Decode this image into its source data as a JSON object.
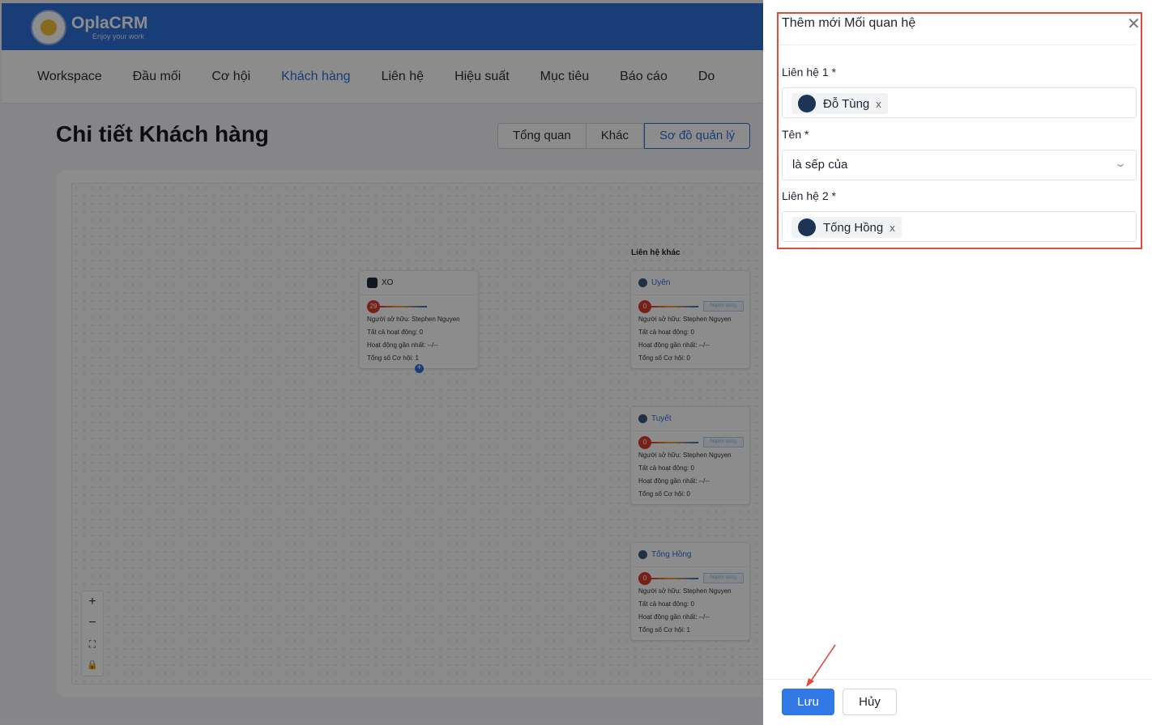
{
  "app": {
    "logo_name": "OplaCRM",
    "logo_tagline": "Enjoy your work",
    "nav": [
      "Workspace",
      "Đầu mối",
      "Cơ hội",
      "Khách hàng",
      "Liên hệ",
      "Hiệu suất",
      "Mục tiêu",
      "Báo cáo",
      "Do"
    ],
    "active_nav": "Khách hàng",
    "page_title": "Chi tiết Khách hàng",
    "view_tabs": [
      "Tổng quan",
      "Khác",
      "Sơ đồ quản lý"
    ],
    "active_view_tab": "Sơ đồ quản lý",
    "group_label": "Liên hệ khác",
    "nodes": [
      {
        "name": "XO",
        "score": "29",
        "owner": "Người sở hữu: Stephen Nguyen",
        "activities": "Tất cả hoạt động: 0",
        "last_activity": "Hoạt động gần nhất: --/--",
        "opportunities": "Tổng số Cơ hội: 1"
      },
      {
        "name": "Uyên",
        "score": "0",
        "badge": "Người dùng",
        "owner": "Người sở hữu: Stephen Nguyen",
        "activities": "Tất cả hoạt động: 0",
        "last_activity": "Hoạt động gần nhất: --/--",
        "opportunities": "Tổng số Cơ hội: 0"
      },
      {
        "name": "Tuyết",
        "score": "0",
        "badge": "Người dùng",
        "owner": "Người sở hữu: Stephen Nguyen",
        "activities": "Tất cả hoạt động: 0",
        "last_activity": "Hoạt động gần nhất: --/--",
        "opportunities": "Tổng số Cơ hội: 0"
      },
      {
        "name": "Tống Hồng",
        "score": "0",
        "badge": "Người dùng",
        "owner": "Người sở hữu: Stephen Nguyen",
        "activities": "Tất cả hoạt động: 0",
        "last_activity": "Hoạt động gần nhất: --/--",
        "opportunities": "Tổng số Cơ hội: 1"
      }
    ],
    "zoom_controls": [
      "+",
      "−",
      "⛶",
      "🔒"
    ],
    "icons": {
      "zoom_in": "plus-icon",
      "zoom_out": "minus-icon",
      "fit": "fit-view-icon",
      "lock": "lock-icon"
    }
  },
  "drawer": {
    "title": "Thêm mới Mối quan hệ",
    "close_glyph": "✕",
    "contact1_label": "Liên hệ 1 *",
    "contact1_value": "Đỗ Tùng",
    "name_label": "Tên *",
    "name_value": "là sếp của",
    "contact2_label": "Liên hệ 2 *",
    "contact2_value": "Tống Hồng",
    "remove_glyph": "x",
    "save_label": "Lưu",
    "cancel_label": "Hủy"
  },
  "colors": {
    "brand": "#2c6fd9",
    "highlight": "#e04b3a",
    "save_button": "#2f78e6"
  }
}
